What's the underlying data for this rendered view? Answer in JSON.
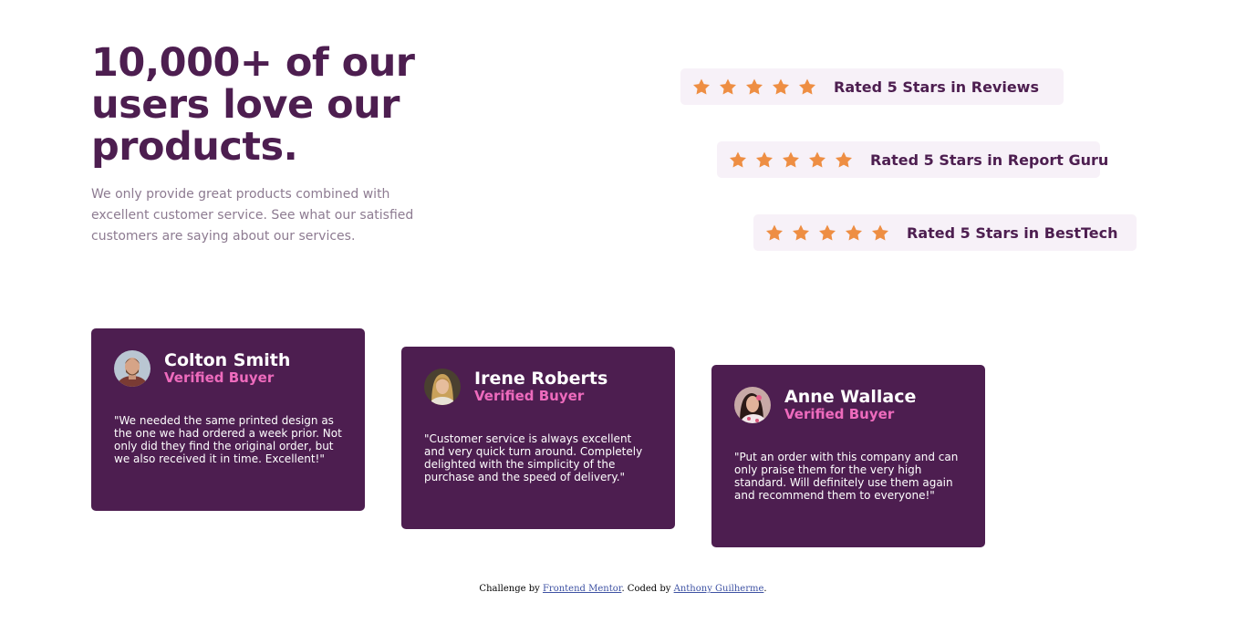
{
  "hero": {
    "headline": "10,000+ of our users love our products.",
    "description": "We only provide great products combined with excellent customer service. See what our satisfied customers are saying about our services."
  },
  "ratings": [
    {
      "label": "Rated 5 Stars in Reviews",
      "stars": 5
    },
    {
      "label": "Rated 5 Stars in Report Guru",
      "stars": 5
    },
    {
      "label": "Rated 5 Stars in BestTech",
      "stars": 5
    }
  ],
  "testimonials": [
    {
      "name": "Colton Smith",
      "badge": "Verified Buyer",
      "quote": "\"We needed the same printed design as the one we had ordered a week prior. Not only did they find the original order, but we also received it in time. Excellent!\""
    },
    {
      "name": "Irene Roberts",
      "badge": "Verified Buyer",
      "quote": "\"Customer service is always excellent and very quick turn around. Completely delighted with the simplicity of the purchase and the speed of delivery.\""
    },
    {
      "name": "Anne Wallace",
      "badge": "Verified Buyer",
      "quote": "\"Put an order with this company and can only praise them for the very high standard. Will definitely use them again and recommend them to everyone!\""
    }
  ],
  "footer": {
    "prefix": "Challenge by ",
    "link1": "Frontend Mentor",
    "middle": ". Coded by ",
    "link2": "Anthony Guilherme",
    "suffix": "."
  },
  "icons": {
    "star": "star-icon"
  },
  "colors": {
    "dark_magenta": "#4d1e50",
    "soft_pink": "#ee6bbd",
    "star_orange": "#ee8e43",
    "rating_bg": "#f7f1f8",
    "grayish_magenta": "#8d7b91"
  }
}
